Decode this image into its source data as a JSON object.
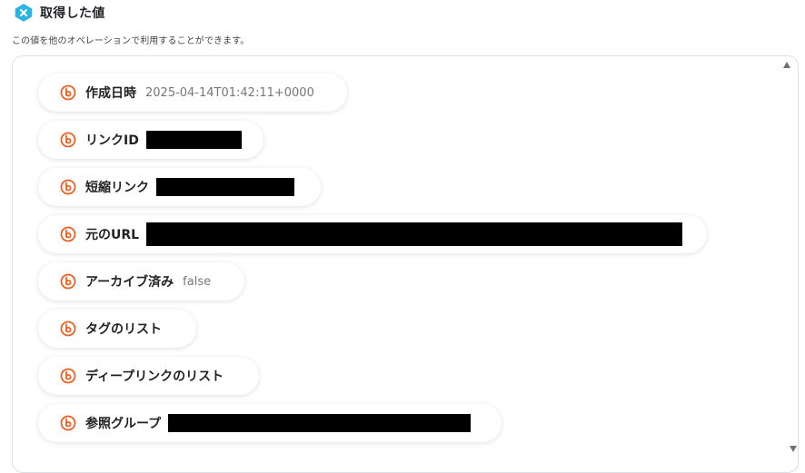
{
  "header": {
    "title": "取得した値",
    "icon": "x-icon",
    "accent": "#2bb3e6"
  },
  "description": "この値を他のオペレーションで利用することができます。",
  "item_icon": {
    "name": "bitly-icon",
    "color": "#ee6123"
  },
  "items": [
    {
      "label": "作成日時",
      "value": "2025-04-14T01:42:11+0000"
    },
    {
      "label": "リンクID",
      "value": ""
    },
    {
      "label": "短縮リンク",
      "value": ""
    },
    {
      "label": "元のURL",
      "value": ""
    },
    {
      "label": "アーカイブ済み",
      "value": "false"
    },
    {
      "label": "タグのリスト",
      "value": ""
    },
    {
      "label": "ディープリンクのリスト",
      "value": ""
    },
    {
      "label": "参照グループ",
      "value": ""
    }
  ]
}
